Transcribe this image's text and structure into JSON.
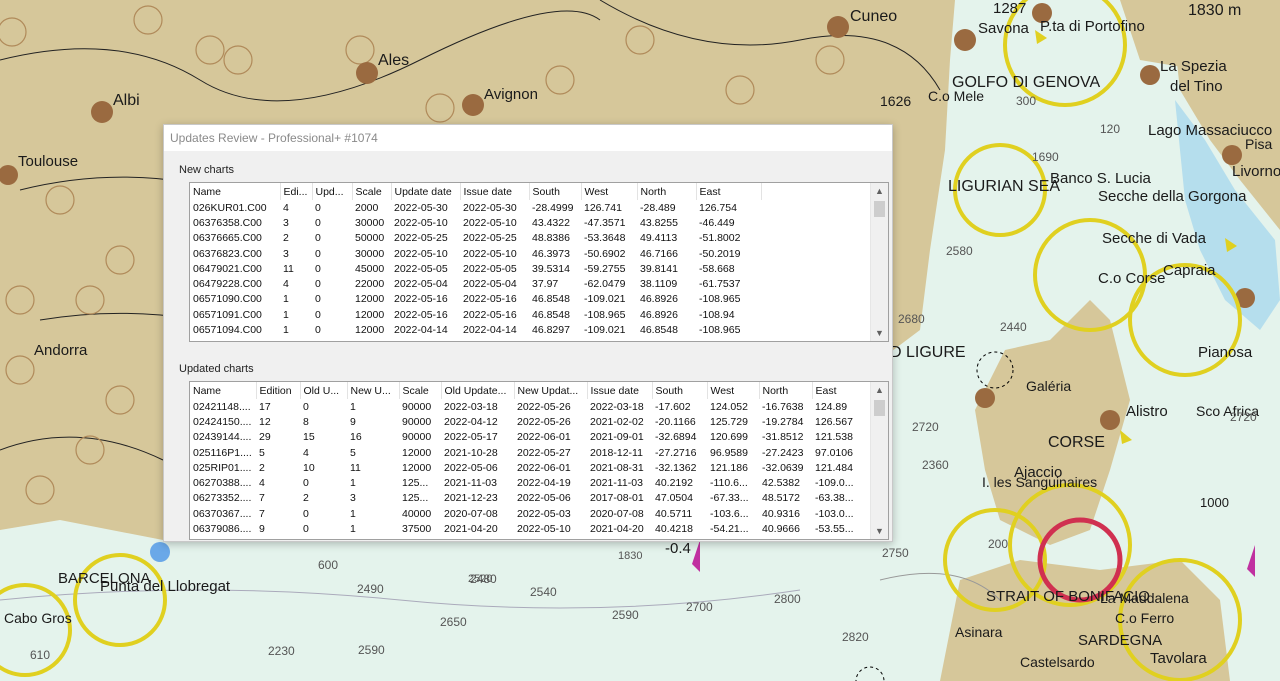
{
  "window": {
    "title": "Updates Review - Professional+ #1074"
  },
  "new_charts": {
    "label": "New charts",
    "columns": [
      "Name",
      "Edi...",
      "Upd...",
      "Scale",
      "Update date",
      "Issue date",
      "South",
      "West",
      "North",
      "East"
    ],
    "rows": [
      [
        "026KUR01.C00",
        "4",
        "0",
        "2000",
        "2022-05-30",
        "2022-05-30",
        "-28.4999",
        "126.741",
        "-28.489",
        "126.754"
      ],
      [
        "06376358.C00",
        "3",
        "0",
        "30000",
        "2022-05-10",
        "2022-05-10",
        "43.4322",
        "-47.3571",
        "43.8255",
        "-46.449"
      ],
      [
        "06376665.C00",
        "2",
        "0",
        "50000",
        "2022-05-25",
        "2022-05-25",
        "48.8386",
        "-53.3648",
        "49.4113",
        "-51.8002"
      ],
      [
        "06376823.C00",
        "3",
        "0",
        "30000",
        "2022-05-10",
        "2022-05-10",
        "46.3973",
        "-50.6902",
        "46.7166",
        "-50.2019"
      ],
      [
        "06479021.C00",
        "11",
        "0",
        "45000",
        "2022-05-05",
        "2022-05-05",
        "39.5314",
        "-59.2755",
        "39.8141",
        "-58.668"
      ],
      [
        "06479228.C00",
        "4",
        "0",
        "22000",
        "2022-05-04",
        "2022-05-04",
        "37.97",
        "-62.0479",
        "38.1109",
        "-61.7537"
      ],
      [
        "06571090.C00",
        "1",
        "0",
        "12000",
        "2022-05-16",
        "2022-05-16",
        "46.8548",
        "-109.021",
        "46.8926",
        "-108.965"
      ],
      [
        "06571091.C00",
        "1",
        "0",
        "12000",
        "2022-05-16",
        "2022-05-16",
        "46.8548",
        "-108.965",
        "46.8926",
        "-108.94"
      ],
      [
        "06571094.C00",
        "1",
        "0",
        "12000",
        "2022-04-14",
        "2022-04-14",
        "46.8297",
        "-109.021",
        "46.8548",
        "-108.965"
      ]
    ]
  },
  "updated_charts": {
    "label": "Updated charts",
    "columns": [
      "Name",
      "Edition",
      "Old U...",
      "New U...",
      "Scale",
      "Old Update...",
      "New Updat...",
      "Issue date",
      "South",
      "West",
      "North",
      "East"
    ],
    "rows": [
      [
        "02421148....",
        "17",
        "0",
        "1",
        "90000",
        "2022-03-18",
        "2022-05-26",
        "2022-03-18",
        "-17.602",
        "124.052",
        "-16.7638",
        "124.89"
      ],
      [
        "02424150....",
        "12",
        "8",
        "9",
        "90000",
        "2022-04-12",
        "2022-05-26",
        "2021-02-02",
        "-20.1166",
        "125.729",
        "-19.2784",
        "126.567"
      ],
      [
        "02439144....",
        "29",
        "15",
        "16",
        "90000",
        "2022-05-17",
        "2022-06-01",
        "2021-09-01",
        "-32.6894",
        "120.699",
        "-31.8512",
        "121.538"
      ],
      [
        "025116P1....",
        "5",
        "4",
        "5",
        "12000",
        "2021-10-28",
        "2022-05-27",
        "2018-12-11",
        "-27.2716",
        "96.9589",
        "-27.2423",
        "97.0106"
      ],
      [
        "025RIP01....",
        "2",
        "10",
        "11",
        "12000",
        "2022-05-06",
        "2022-06-01",
        "2021-08-31",
        "-32.1362",
        "121.186",
        "-32.0639",
        "121.484"
      ],
      [
        "06270388....",
        "4",
        "0",
        "1",
        "125...",
        "2021-11-03",
        "2022-04-19",
        "2021-11-03",
        "40.2192",
        "-110.6...",
        "42.5382",
        "-109.0..."
      ],
      [
        "06273352....",
        "7",
        "2",
        "3",
        "125...",
        "2021-12-23",
        "2022-05-06",
        "2017-08-01",
        "47.0504",
        "-67.33...",
        "48.5172",
        "-63.38..."
      ],
      [
        "06370367....",
        "7",
        "0",
        "1",
        "40000",
        "2020-07-08",
        "2022-05-03",
        "2020-07-08",
        "40.5711",
        "-103.6...",
        "40.9316",
        "-103.0..."
      ],
      [
        "06379086....",
        "9",
        "0",
        "1",
        "37500",
        "2021-04-20",
        "2022-05-10",
        "2021-04-20",
        "40.4218",
        "-54.21...",
        "40.9666",
        "-53.55..."
      ]
    ]
  },
  "map": {
    "land_color": "#d6c79a",
    "sea_color": "#e4f3ec",
    "labels": [
      "Cuneo",
      "Savona",
      "P.ta di Portofino",
      "1830 m",
      "1287",
      "Ales",
      "Avignon",
      "Albi",
      "Toulouse",
      "GOLFO DI GENOVA",
      "La Spezia",
      "del Tino",
      "1626",
      "C.o Mele",
      "Lago Massaciucco",
      "Pisa",
      "Livorno",
      "LIGURIAN SEA",
      "Banco S. Lucia",
      "Secche della Gorgona",
      "Secche di Vada",
      "C.o Corse",
      "Capraia",
      "Andorra",
      "D LIGURE",
      "Galéria",
      "CORSE",
      "Alistro",
      "Sco Africa",
      "Pianosa",
      "Ajaccio",
      "I. les Sanguinaires",
      "STRAIT OF BONIFACIO",
      "SARDEGNA",
      "C.o Ferro",
      "Tavolara",
      "Castelsardo",
      "Asinara",
      "La Maddalena",
      "BARCELONA",
      "Punta del Llobregat",
      "Cabo Gros",
      "-0.4",
      "1000",
      "2720",
      "2360",
      "2750",
      "2480",
      "2490",
      "2520",
      "2540",
      "2590",
      "2650",
      "2700",
      "2800",
      "2820",
      "2230",
      "2590",
      "600",
      "1830",
      "610",
      "200",
      "300",
      "120",
      "1690",
      "2580",
      "2440",
      "2680",
      "2720"
    ]
  }
}
